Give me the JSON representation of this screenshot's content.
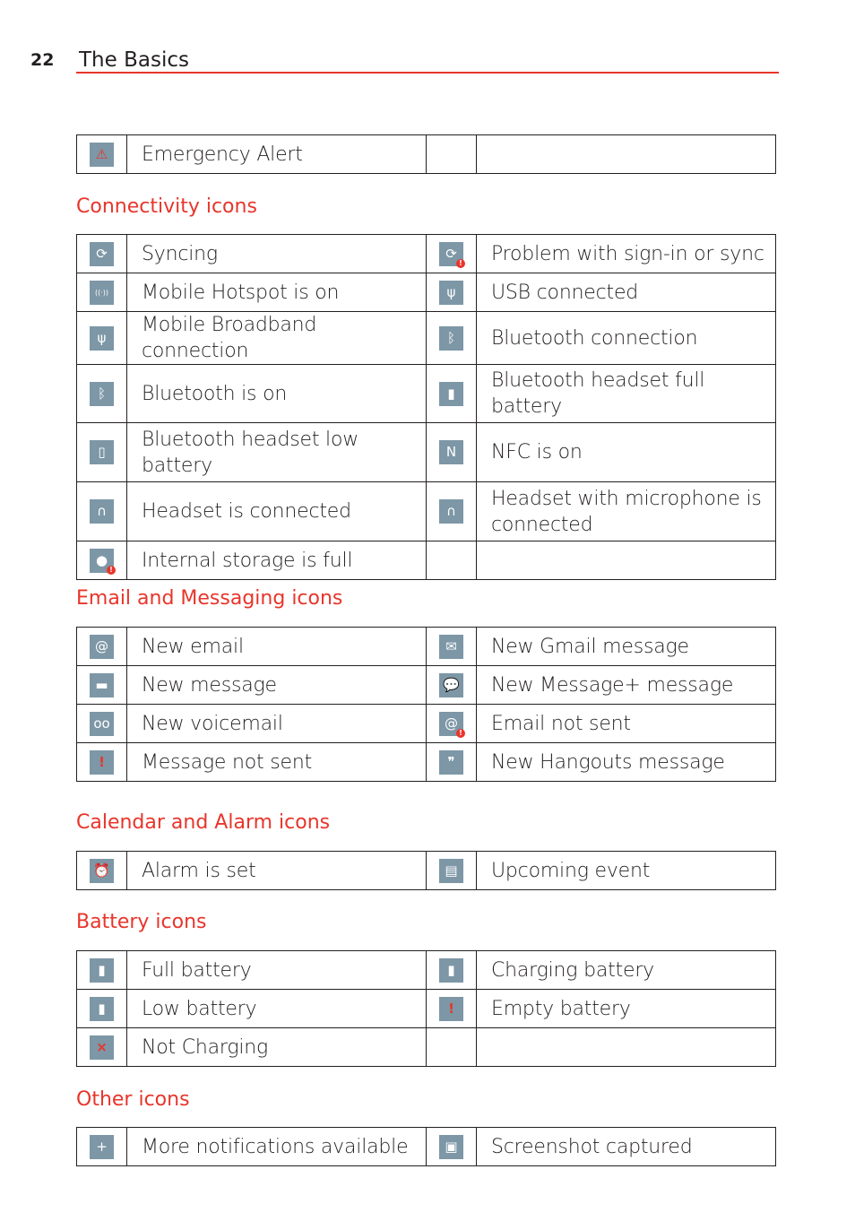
{
  "header": {
    "page_number": "22",
    "title": "The Basics"
  },
  "colors": {
    "accent": "#e8352b",
    "icon_bg": "#7d97a6",
    "text": "#231f20"
  },
  "top_table": {
    "rows": [
      {
        "left": {
          "icon": "warning-icon",
          "glyph": "⚠",
          "label": "Emergency Alert"
        },
        "right": null
      }
    ]
  },
  "sections": [
    {
      "heading": "Connectivity icons",
      "rows": [
        {
          "left": {
            "icon": "sync-icon",
            "glyph": "⟳",
            "label": "Syncing"
          },
          "right": {
            "icon": "sync-problem-icon",
            "glyph": "⟳",
            "label": "Problem with sign-in or sync",
            "badge": "!"
          }
        },
        {
          "left": {
            "icon": "hotspot-icon",
            "glyph": "((·))",
            "label": "Mobile Hotspot is on"
          },
          "right": {
            "icon": "usb-icon",
            "glyph": "ψ",
            "label": "USB connected"
          }
        },
        {
          "left": {
            "icon": "mobile-broadband-icon",
            "glyph": "ψ",
            "label": "Mobile Broadband connection"
          },
          "right": {
            "icon": "bluetooth-connected-icon",
            "glyph": "ᛒ",
            "label": "Bluetooth connection"
          }
        },
        {
          "left": {
            "icon": "bluetooth-icon",
            "glyph": "ᛒ",
            "label": "Bluetooth is on"
          },
          "right": {
            "icon": "bluetooth-headset-full-battery-icon",
            "glyph": "▮",
            "label": "Bluetooth headset full battery"
          }
        },
        {
          "left": {
            "icon": "bluetooth-headset-low-battery-icon",
            "glyph": "▯",
            "label": "Bluetooth headset low battery"
          },
          "right": {
            "icon": "nfc-icon",
            "glyph": "N",
            "label": "NFC is on"
          }
        },
        {
          "left": {
            "icon": "headset-icon",
            "glyph": "∩",
            "label": "Headset is connected"
          },
          "right": {
            "icon": "headset-microphone-icon",
            "glyph": "∩",
            "label": "Headset with microphone is connected"
          }
        },
        {
          "left": {
            "icon": "storage-full-icon",
            "glyph": "●",
            "label": "Internal storage is full",
            "badge": "!"
          },
          "right": null
        }
      ]
    },
    {
      "heading": "Email and Messaging icons",
      "rows": [
        {
          "left": {
            "icon": "email-icon",
            "glyph": "@",
            "label": "New email"
          },
          "right": {
            "icon": "gmail-icon",
            "glyph": "✉",
            "label": "New Gmail message"
          }
        },
        {
          "left": {
            "icon": "message-icon",
            "glyph": "▬",
            "label": "New message"
          },
          "right": {
            "icon": "message-plus-icon",
            "glyph": "💬",
            "label": "New Message+ message"
          }
        },
        {
          "left": {
            "icon": "voicemail-icon",
            "glyph": "oo",
            "label": "New voicemail"
          },
          "right": {
            "icon": "email-not-sent-icon",
            "glyph": "@",
            "label": "Email not sent",
            "badge": "!"
          }
        },
        {
          "left": {
            "icon": "message-not-sent-icon",
            "glyph": "!",
            "label": "Message not sent"
          },
          "right": {
            "icon": "hangouts-icon",
            "glyph": "❞",
            "label": "New Hangouts message"
          }
        }
      ]
    },
    {
      "heading": "Calendar and Alarm icons",
      "rows": [
        {
          "left": {
            "icon": "alarm-icon",
            "glyph": "⏰",
            "label": "Alarm is set"
          },
          "right": {
            "icon": "calendar-icon",
            "glyph": "▤",
            "label": "Upcoming event"
          }
        }
      ]
    },
    {
      "heading": "Battery icons",
      "rows": [
        {
          "left": {
            "icon": "battery-full-icon",
            "glyph": "▮",
            "label": "Full battery"
          },
          "right": {
            "icon": "battery-charging-icon",
            "glyph": "▮",
            "label": "Charging battery"
          }
        },
        {
          "left": {
            "icon": "battery-low-icon",
            "glyph": "▮",
            "label": "Low battery"
          },
          "right": {
            "icon": "battery-empty-icon",
            "glyph": "!",
            "label": "Empty battery"
          }
        },
        {
          "left": {
            "icon": "battery-not-charging-icon",
            "glyph": "×",
            "label": "Not Charging"
          },
          "right": null
        }
      ]
    },
    {
      "heading": "Other icons",
      "rows": [
        {
          "left": {
            "icon": "more-notifications-icon",
            "glyph": "+",
            "label": "More notifications available"
          },
          "right": {
            "icon": "screenshot-icon",
            "glyph": "▣",
            "label": "Screenshot captured"
          }
        }
      ]
    }
  ]
}
